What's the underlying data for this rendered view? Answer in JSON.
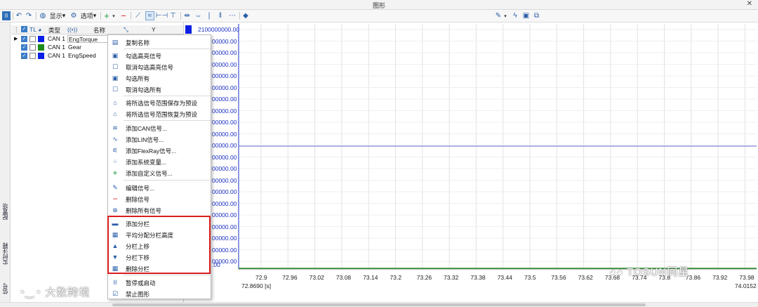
{
  "window": {
    "title": "图形",
    "close_glyph": "✕"
  },
  "toolbar": {
    "display_label": "显示",
    "options_label": "选项"
  },
  "side_tabs": [
    "配置项",
    "实时注释",
    "信号"
  ],
  "signal_table": {
    "headers": {
      "tl": "TL",
      "type": "类型",
      "name": "名称",
      "y": "Y"
    },
    "rows": [
      {
        "type": "CAN 1",
        "name": "EngTorque",
        "color": "#0a20e6",
        "checked": true
      },
      {
        "type": "CAN 1",
        "name": "Gear",
        "color": "#1c8a1c",
        "checked": true
      },
      {
        "type": "CAN 1",
        "name": "EngSpeed",
        "color": "#0a20e6",
        "checked": true
      }
    ]
  },
  "context_menu": {
    "items": [
      {
        "label": "复制名称",
        "icon": "copy-icon"
      },
      {
        "label": "勾选高亮信号",
        "icon": "check-square-icon"
      },
      {
        "label": "取消勾选高亮信号",
        "icon": "empty-square-icon"
      },
      {
        "label": "勾选所有",
        "icon": "check-square-icon"
      },
      {
        "label": "取消勾选所有",
        "icon": "empty-square-icon"
      },
      {
        "label": "将所选信号范围保存为预设",
        "icon": "home-icon"
      },
      {
        "label": "将所选信号范围恢复为预设",
        "icon": "home-outline-icon"
      },
      {
        "label": "添加CAN信号...",
        "icon": "can-icon"
      },
      {
        "label": "添加LIN信号...",
        "icon": "lin-icon"
      },
      {
        "label": "添加FlexRay信号...",
        "icon": "flexray-icon"
      },
      {
        "label": "添加系统变量...",
        "icon": "system-variable-icon"
      },
      {
        "label": "添加自定义信号...",
        "icon": "plus-icon"
      },
      {
        "label": "编辑信号...",
        "icon": "pencil-icon"
      },
      {
        "label": "删除信号",
        "icon": "minus-icon"
      },
      {
        "label": "删除所有信号",
        "icon": "delete-all-icon"
      },
      {
        "label": "添加分栏",
        "icon": "add-pane-icon"
      },
      {
        "label": "平均分配分栏高度",
        "icon": "equal-height-icon"
      },
      {
        "label": "分栏上移",
        "icon": "triangle-up-icon"
      },
      {
        "label": "分栏下移",
        "icon": "triangle-down-icon"
      },
      {
        "label": "删除分栏",
        "icon": "delete-pane-icon"
      },
      {
        "label": "暂停或启动",
        "icon": "pause-icon"
      },
      {
        "label": "禁止图形",
        "icon": "checked-box-icon"
      }
    ]
  },
  "chart": {
    "y_ticks": [
      "2100000000.00",
      "00000.00",
      "00000.00",
      "00000.00",
      "00000.00",
      "00000.00",
      "00000.00",
      "00000.00",
      "00000.00",
      "00000.00",
      "00000.00",
      "00000.00",
      "00000.00",
      "00000.00",
      "00000.00",
      "00000.00",
      "00000.00",
      "00000.00",
      "00000.00",
      "00000.00",
      "00000.00",
      ".00"
    ],
    "x_ticks": [
      "72.9",
      "72.96",
      "73.02",
      "73.08",
      "73.14",
      "73.2",
      "73.26",
      "73.32",
      "73.38",
      "73.44",
      "73.5",
      "73.56",
      "73.62",
      "73.68",
      "73.74",
      "73.8",
      "73.86",
      "73.92",
      "73.98"
    ],
    "x_start_label": "72.8690 [s]",
    "x_end_label": "74.0152",
    "series_colors": {
      "horizontal_line": "#8585e0",
      "bottom_line": "#1c8a1c"
    }
  },
  "watermarks": {
    "left": "大数跨境",
    "right": "TOSUN同星"
  }
}
